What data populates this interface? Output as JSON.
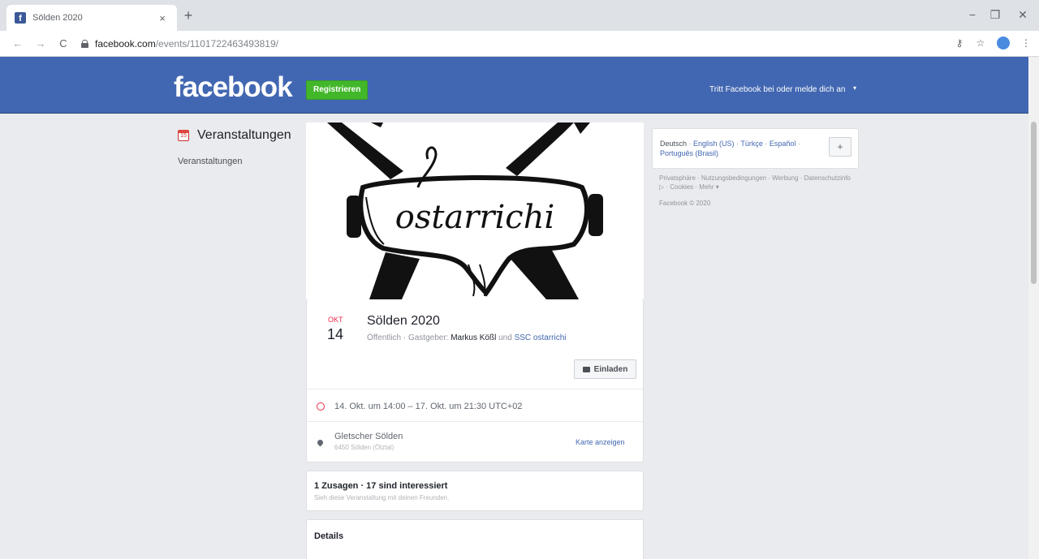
{
  "browser": {
    "tab_title": "Sölden 2020",
    "tab_close": "×",
    "new_tab": "+",
    "url_host": "facebook.com",
    "url_path": "/events/1101722463493819/",
    "minimize": "−",
    "maximize": "❐",
    "close": "✕",
    "back": "←",
    "forward": "→",
    "reload": "C",
    "key_icon": "⚷",
    "star": "☆",
    "menu": "⋮"
  },
  "header": {
    "logo": "facebook",
    "register_label": "Registrieren",
    "join_text": "Tritt Facebook bei oder melde dich an",
    "caret": "▾"
  },
  "leftnav": {
    "title": "Veranstaltungen",
    "items": [
      "Veranstaltungen"
    ]
  },
  "event": {
    "month": "OKT",
    "day": "14",
    "title": "Sölden 2020",
    "privacy": "Öffentlich",
    "host_prefix": " · Gastgeber: ",
    "host": "Markus Kößl",
    "and": " und ",
    "co_host": "SSC ostarrichi",
    "invite_label": "Einladen",
    "time": "14. Okt. um 14:00 – 17. Okt. um 21:30 UTC+02",
    "location_name": "Gletscher Sölden",
    "location_address": "6450 Sölden (Ötztal)",
    "map_link": "Karte anzeigen",
    "cover_text": "ostarrichi"
  },
  "attendance": {
    "title": "1 Zusagen · 17 sind interessiert",
    "subtitle": "Sieh diese Veranstaltung mit deinen Freunden."
  },
  "details": {
    "title": "Details"
  },
  "languages": {
    "current": "Deutsch",
    "items": [
      "English (US)",
      "Türkçe",
      "Español",
      "Português (Brasil)"
    ],
    "plus": "+"
  },
  "footer": {
    "links": "Privatsphäre · Nutzungsbedingungen · Werbung · Datenschutzinfo ▷ · Cookies · Mehr ▾",
    "copyright": "Facebook © 2020"
  },
  "colors": {
    "fb_blue": "#4267b2",
    "register_green": "#42b72a",
    "date_red": "#f02849"
  }
}
